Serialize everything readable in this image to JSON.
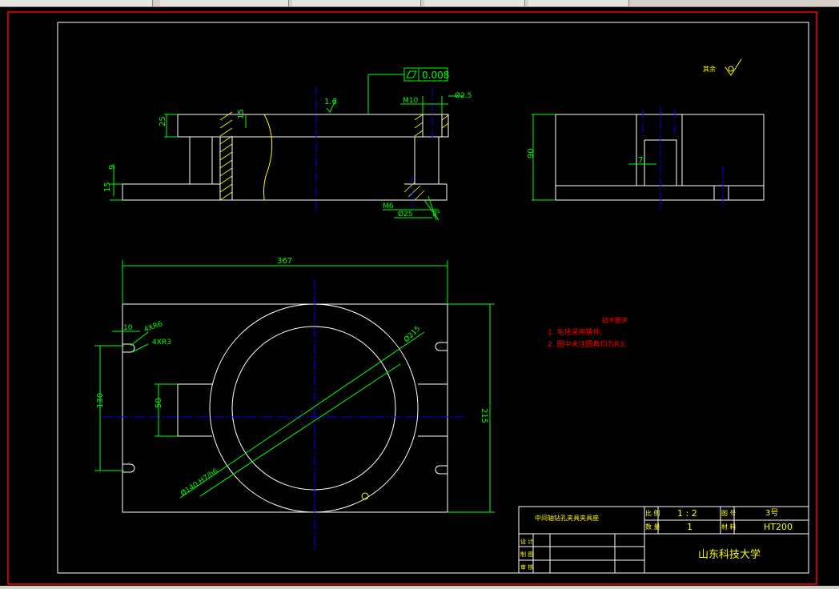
{
  "front_view": {
    "flatness_value": "0.008",
    "roughness_16": "1.6",
    "dim_25": "25",
    "dim_15_top": "15",
    "dim_9": "9",
    "dim_15_bottom": "15",
    "thread_m10": "M10",
    "dim_phi2_5": "Ø2.5",
    "thread_m6": "M6",
    "dim_phi25": "Ø25",
    "angle_label": "8°"
  },
  "side_view": {
    "dim_90": "90",
    "dim_7": "7"
  },
  "top_view": {
    "dim_367": "367",
    "dim_215": "215",
    "dim_130": "130",
    "dim_50": "50",
    "dim_10": "10",
    "dim_4xr6": "4XR6",
    "dim_4xr3": "4XR3",
    "dim_phi215": "Ø215",
    "dim_phi140": "Ø140 H7/h6"
  },
  "notes": {
    "roughness_rest_label": "其余",
    "title": "技术要求",
    "item1": "1. 毛坯采用铸件;",
    "item2": "2. 图中未注圆角均为R3;"
  },
  "title_block": {
    "part_name": "中间轴钻孔夹具夹具座",
    "scale_label": "比 例",
    "scale_value": "1 : 2",
    "drawing_no_label": "图 号",
    "drawing_no_value": "3号",
    "quantity_label": "数 量",
    "quantity_value": "1",
    "material_label": "材 料",
    "material_value": "HT200",
    "designer_label": "设 计",
    "drafter_label": "制 图",
    "reviewer_label": "审 核",
    "school": "山东科技大学"
  },
  "colors": {
    "outline": "#ffffff",
    "dimension": "#00ff00",
    "centerline": "#0000ff",
    "hatch": "#ffff00",
    "note": "#ff0000",
    "border": "#ff0000"
  }
}
